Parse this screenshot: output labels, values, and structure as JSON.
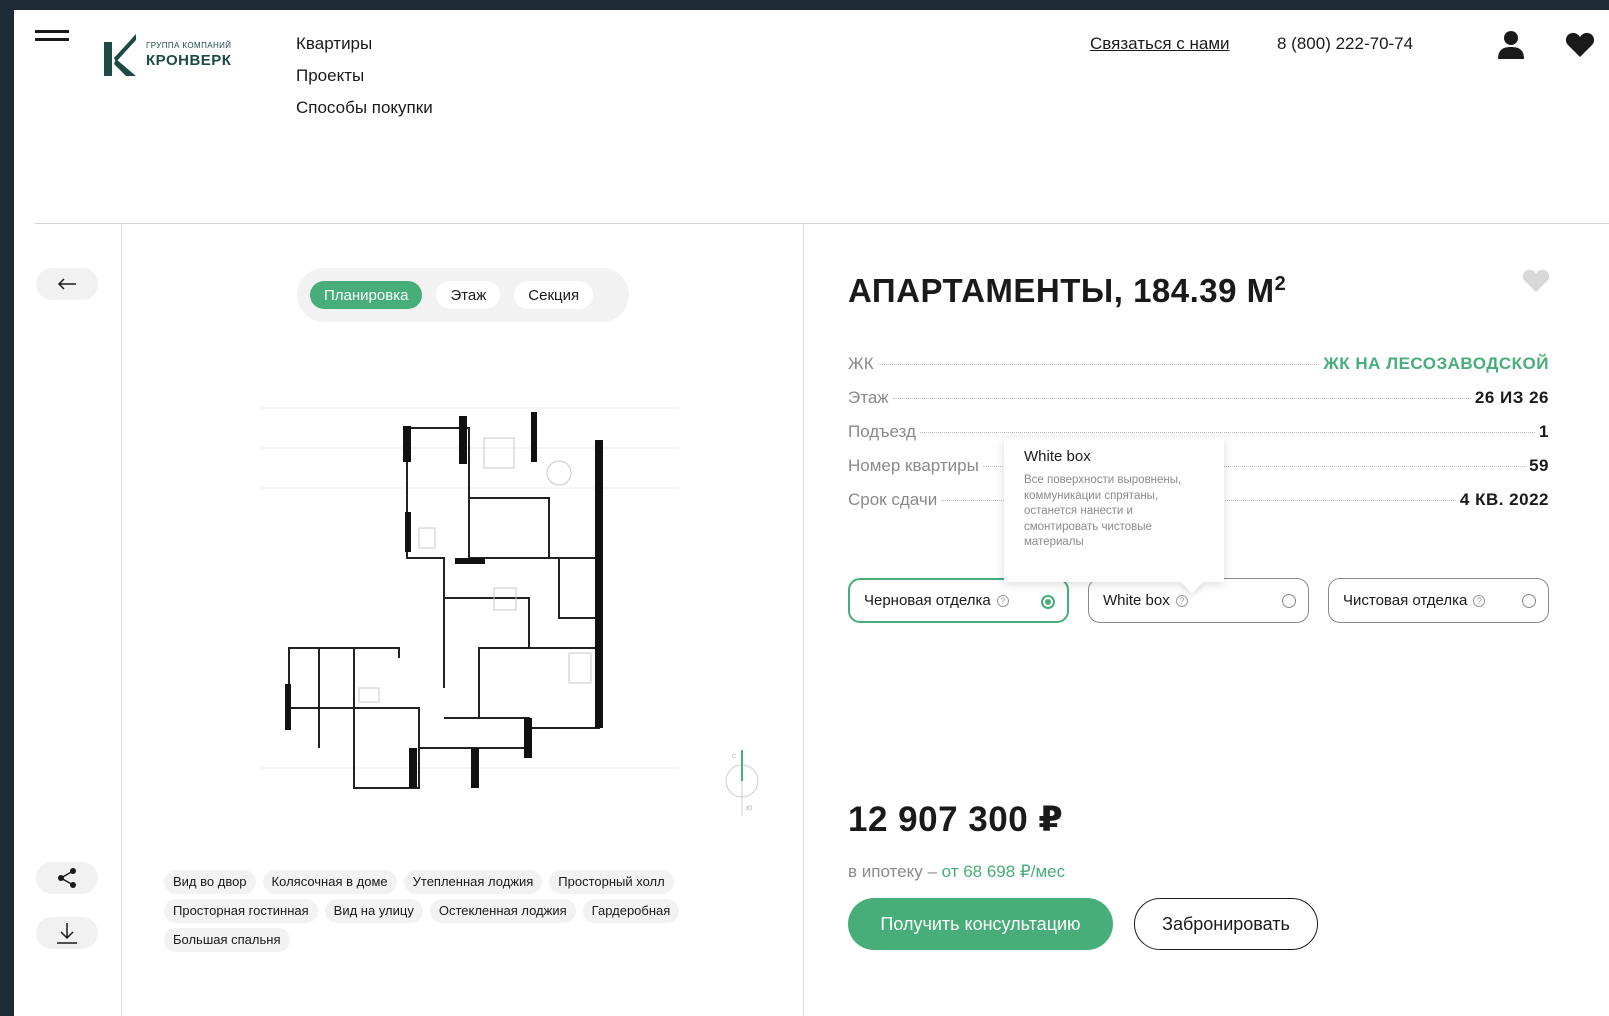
{
  "logo": {
    "small": "ГРУППА КОМПАНИЙ",
    "big": "КРОНВЕРК"
  },
  "nav": [
    "Квартиры",
    "Проекты",
    "Способы покупки"
  ],
  "header": {
    "contact": "Связаться с нами",
    "phone": "8 (800) 222-70-74"
  },
  "plan_tabs": [
    {
      "label": "Планировка",
      "active": true
    },
    {
      "label": "Этаж",
      "active": false
    },
    {
      "label": "Секция",
      "active": false
    }
  ],
  "tags": [
    [
      "Вид во двор",
      "Колясочная в доме",
      "Утепленная лоджия",
      "Просторный холл"
    ],
    [
      "Просторная гостинная",
      "Вид на улицу",
      "Остекленная лоджия",
      "Гардеробная"
    ],
    [
      "Большая спальня"
    ]
  ],
  "title": {
    "text": "АПАРТАМЕНТЫ, 184.39 М",
    "sup": "2"
  },
  "props": [
    {
      "label": "ЖК",
      "value": "ЖК НА ЛЕСОЗАВОДСКОЙ",
      "green": true
    },
    {
      "label": "Этаж",
      "value": "26 ИЗ 26",
      "green": false
    },
    {
      "label": "Подъезд",
      "value": "1",
      "green": false
    },
    {
      "label": "Номер квартиры",
      "value": "59",
      "green": false
    },
    {
      "label": "Срок сдачи",
      "value": "4 КВ. 2022",
      "green": false
    }
  ],
  "tooltip": {
    "title": "White box",
    "text": "Все поверхности выровнены, коммуникации спрятаны, останется нанести и смонтировать чистовые материалы"
  },
  "finishes": [
    {
      "label": "Черновая отделка",
      "selected": true
    },
    {
      "label": "White box",
      "selected": false
    },
    {
      "label": "Чистовая отделка",
      "selected": false
    }
  ],
  "price": "12 907 300 ₽",
  "mortgage": {
    "prefix": "в ипотеку – ",
    "amount": "от 68 698 ₽/мес"
  },
  "buttons": {
    "consult": "Получить консультацию",
    "book": "Забронировать"
  },
  "colors": {
    "accent": "#47ad79",
    "frame": "#1d2b34",
    "logo": "#1d4a44"
  }
}
